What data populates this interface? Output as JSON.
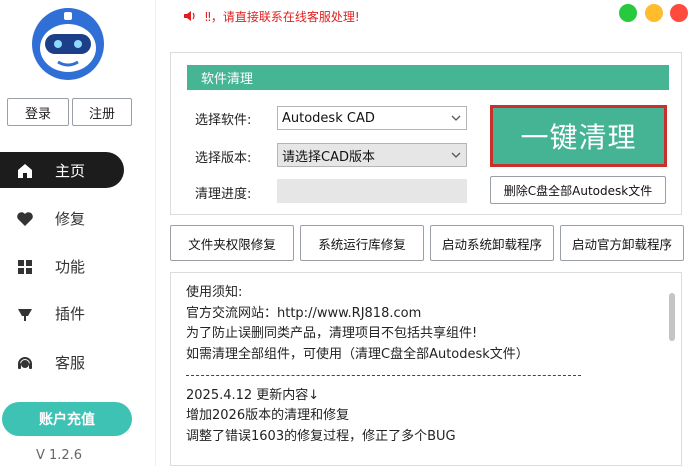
{
  "sidebar": {
    "login_label": "登录",
    "register_label": "注册",
    "nav": [
      {
        "label": "主页",
        "icon": "home-icon",
        "active": true
      },
      {
        "label": "修复",
        "icon": "heart-icon"
      },
      {
        "label": "功能",
        "icon": "grid-icon"
      },
      {
        "label": "插件",
        "icon": "plugin-icon"
      },
      {
        "label": "客服",
        "icon": "headset-icon"
      }
    ],
    "recharge_label": "账户充值",
    "version": "V 1.2.6"
  },
  "topbar": {
    "notice": "‼，请直接联系在线客服处理!",
    "notice_color": "#e02020"
  },
  "panel": {
    "header": "软件清理",
    "software_label": "选择软件:",
    "software_value": "Autodesk CAD",
    "version_label": "选择版本:",
    "version_value": "请选择CAD版本",
    "progress_label": "清理进度:",
    "one_click_label": "一键清理",
    "delete_label": "删除C盘全部Autodesk文件"
  },
  "tools": [
    {
      "label": "文件夹权限修复"
    },
    {
      "label": "系统运行库修复"
    },
    {
      "label": "启动系统卸载程序"
    },
    {
      "label": "启动官方卸载程序"
    }
  ],
  "info": {
    "lines": [
      "使用须知:",
      "官方交流网站：http://www.RJ818.com",
      "为了防止误删同类产品，清理项目不包括共享组件!",
      "如需清理全部组件，可使用（清理C盘全部Autodesk文件）",
      "2025.4.12 更新内容↓",
      "增加2026版本的清理和修复",
      "调整了错误1603的修复过程，修正了多个BUG"
    ]
  },
  "colors": {
    "accent": "#45b594",
    "recharge": "#3ec2b4",
    "highlight_border": "#c9302c"
  }
}
